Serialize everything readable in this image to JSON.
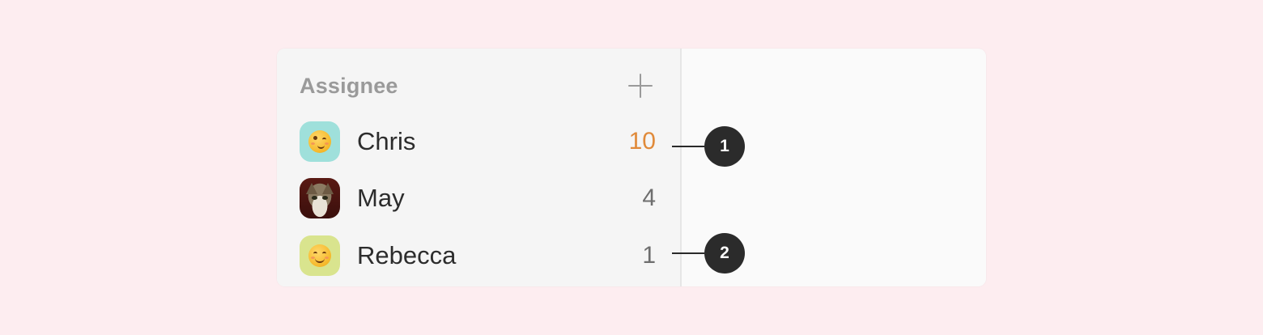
{
  "group": {
    "title": "Assignee",
    "add_icon": "plus-icon"
  },
  "assignees": [
    {
      "name": "Chris",
      "count": "10",
      "avatar": "winking-face-emoji",
      "avatar_bg": "#9fe0db",
      "count_color": "#e08a3a"
    },
    {
      "name": "May",
      "count": "4",
      "avatar": "cat-photo",
      "count_color": "#6e6e6e"
    },
    {
      "name": "Rebecca",
      "count": "1",
      "avatar": "smiling-blushing-face-emoji",
      "avatar_bg": "#d9e48e",
      "count_color": "#6e6e6e"
    }
  ],
  "callouts": [
    {
      "label": "1"
    },
    {
      "label": "2"
    }
  ],
  "colors": {
    "page_background": "#fdedf0",
    "sidebar_background": "#f5f5f5",
    "callout_background": "#2b2b2b",
    "highlight": "#e08a3a"
  }
}
